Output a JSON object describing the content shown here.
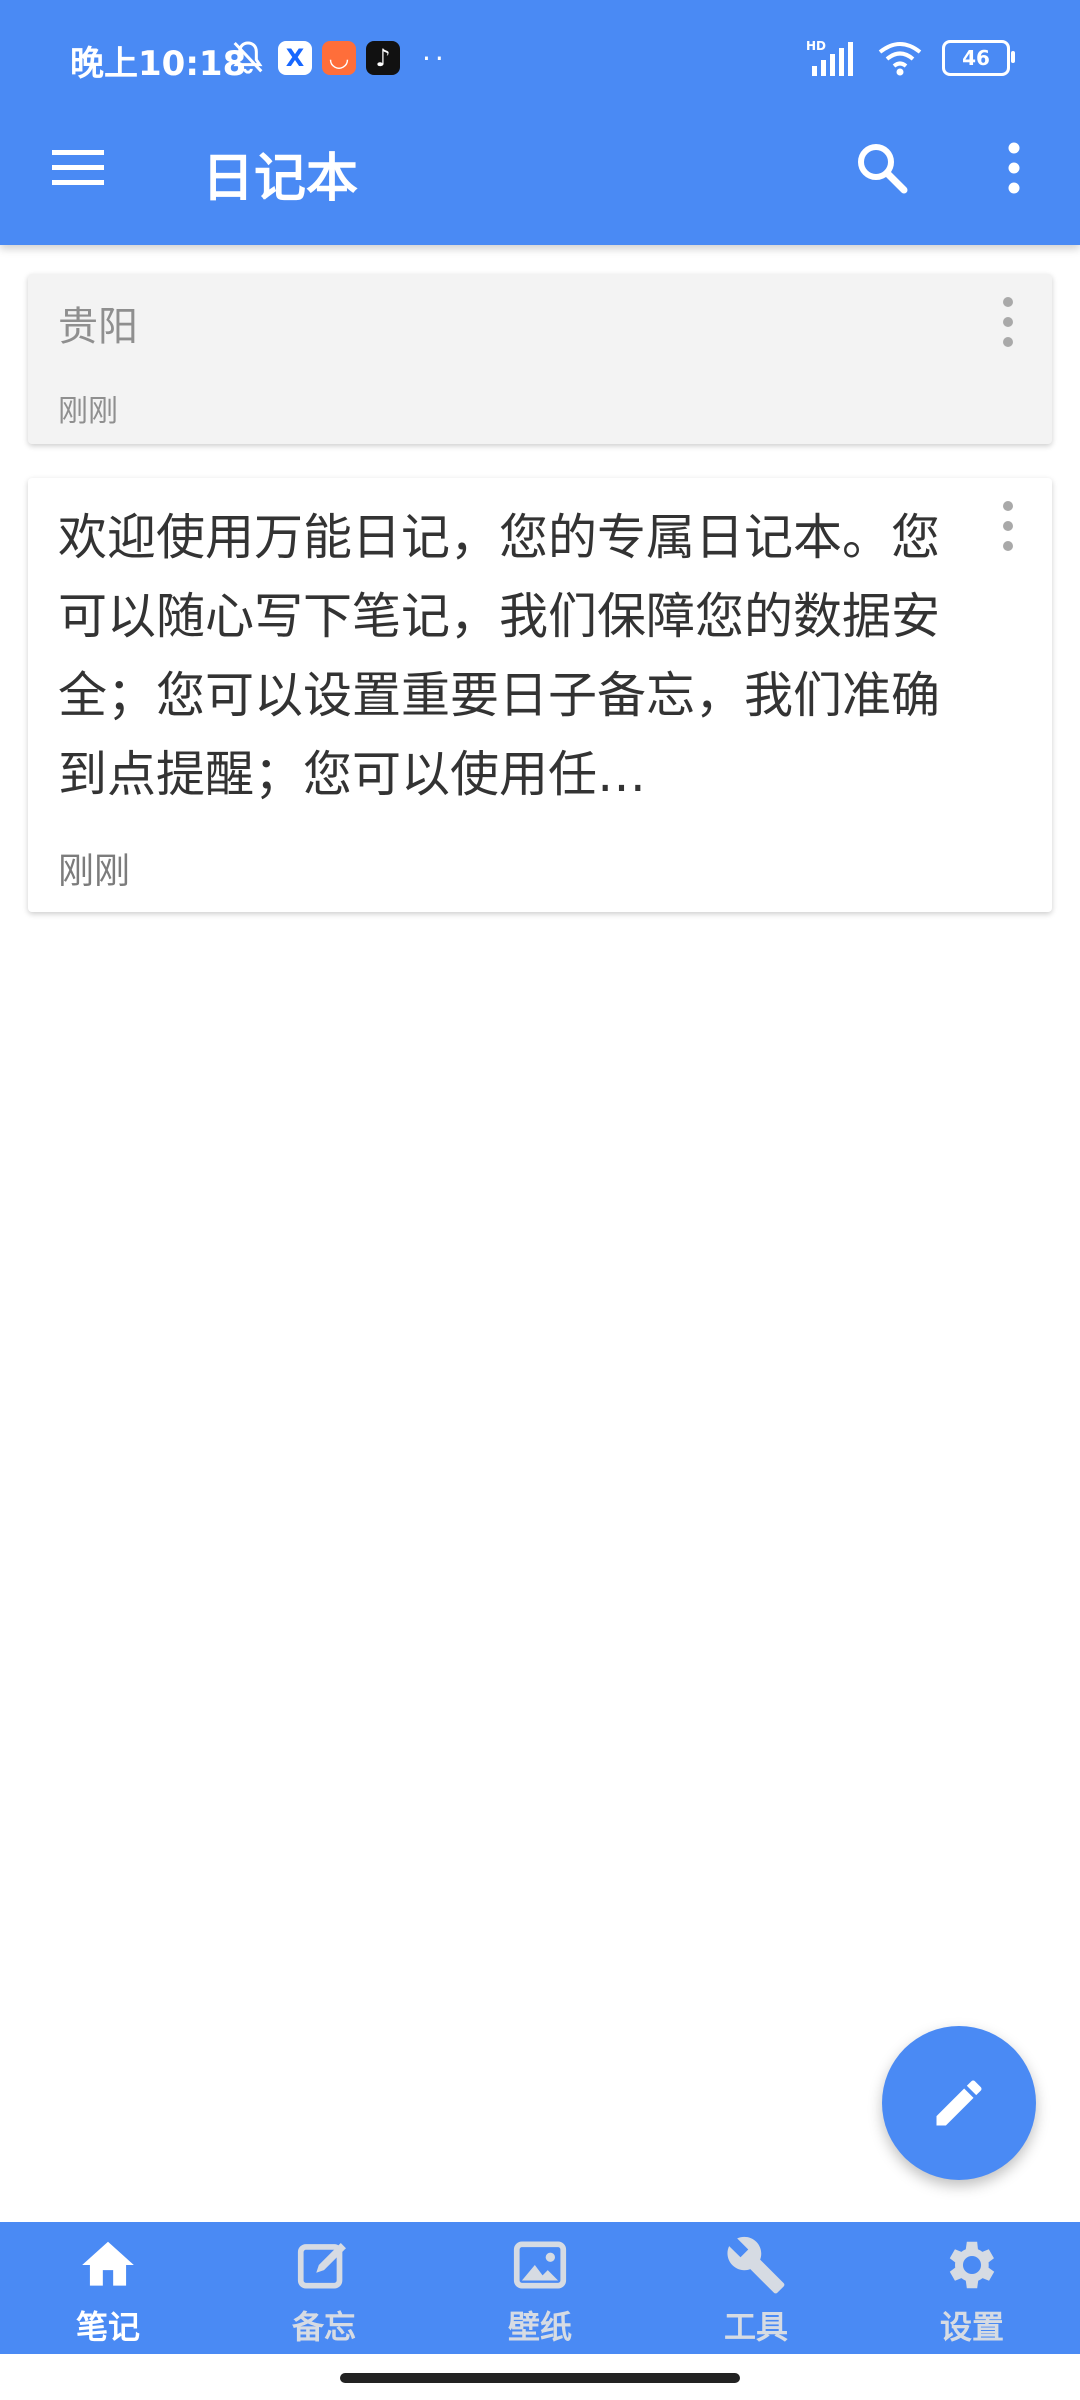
{
  "statusbar": {
    "time": "晚上10:18",
    "battery": "46",
    "signal_label": "HD"
  },
  "appbar": {
    "title": "日记本"
  },
  "notes": [
    {
      "title": "贵阳",
      "time": "刚刚"
    },
    {
      "body": "欢迎使用万能日记，您的专属日记本。您可以随心写下笔记，我们保障您的数据安全；您可以设置重要日子备忘，我们准确到点提醒；您可以使用任…",
      "time": "刚刚"
    }
  ],
  "bottom_nav": [
    {
      "label": "笔记",
      "icon": "home-icon",
      "active": true
    },
    {
      "label": "备忘",
      "icon": "edit-note-icon",
      "active": false
    },
    {
      "label": "壁纸",
      "icon": "image-icon",
      "active": false
    },
    {
      "label": "工具",
      "icon": "wrench-icon",
      "active": false
    },
    {
      "label": "设置",
      "icon": "gear-icon",
      "active": false
    }
  ],
  "colors": {
    "primary": "#4a8af4",
    "inactive_nav": "#d6dbe3"
  }
}
